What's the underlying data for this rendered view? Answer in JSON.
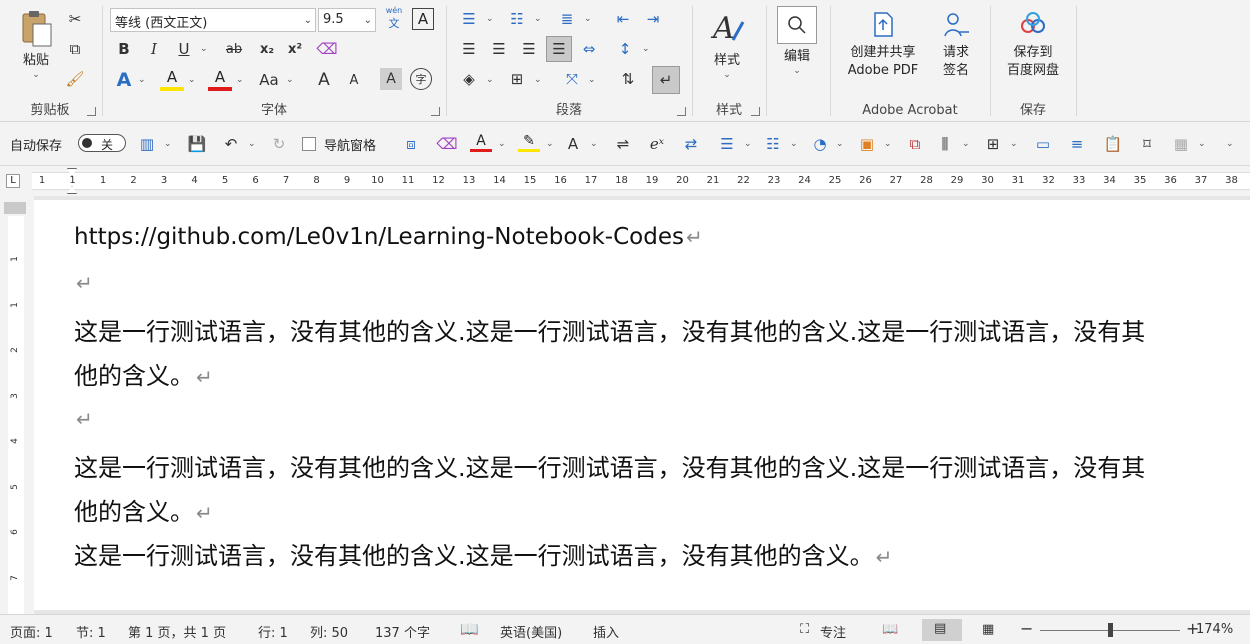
{
  "ribbon": {
    "clipboard": {
      "label": "剪贴板",
      "paste_label": "粘贴"
    },
    "font": {
      "label": "字体",
      "font_name": "等线 (西文正文)",
      "font_size": "9.5",
      "pinyin_top": "wén",
      "pinyin_bottom": "文",
      "border_char": "A",
      "bold": "B",
      "italic": "I",
      "underline": "U",
      "strike": "ab",
      "subscript": "x₂",
      "superscript": "x²",
      "text_effects": "A",
      "highlight": "A",
      "font_color": "A",
      "change_case": "Aa",
      "grow": "A",
      "shrink": "A",
      "shading": "A",
      "enclose": "字"
    },
    "paragraph": {
      "label": "段落"
    },
    "styles": {
      "label": "样式",
      "button_label": "样式"
    },
    "editing": {
      "button_label": "编辑"
    },
    "acrobat": {
      "label": "Adobe Acrobat",
      "create_share_l1": "创建并共享",
      "create_share_l2": "Adobe PDF",
      "request_sign_l1": "请求",
      "request_sign_l2": "签名"
    },
    "save": {
      "label": "保存",
      "save_to_l1": "保存到",
      "save_to_l2": "百度网盘"
    }
  },
  "qat": {
    "autosave_label": "自动保存",
    "autosave_state": "关",
    "nav_pane_label": "导航窗格"
  },
  "ruler": {
    "h_numbers": [
      "1",
      "1",
      "1",
      "2",
      "3",
      "4",
      "5",
      "6",
      "7",
      "8",
      "9",
      "10",
      "11",
      "12",
      "13",
      "14",
      "15",
      "16",
      "17",
      "18",
      "19",
      "20",
      "21",
      "22",
      "23",
      "24",
      "25",
      "26",
      "27",
      "28",
      "29",
      "30",
      "31",
      "32",
      "33",
      "34",
      "35",
      "36",
      "37",
      "38"
    ],
    "v_numbers": [
      "1",
      "1",
      "2",
      "3",
      "4",
      "5",
      "6",
      "7",
      "8"
    ]
  },
  "document": {
    "paragraphs": [
      "https://github.com/Le0v1n/Learning-Notebook-Codes",
      "",
      "这是一行测试语言，没有其他的含义.这是一行测试语言，没有其他的含义.这是一行测试语言，没有其",
      "他的含义。",
      "",
      "这是一行测试语言，没有其他的含义.这是一行测试语言，没有其他的含义.这是一行测试语言，没有其",
      "他的含义。",
      "这是一行测试语言，没有其他的含义.这是一行测试语言，没有其他的含义。"
    ],
    "para_mark": "↵"
  },
  "status": {
    "page": "页面: 1",
    "section": "节: 1",
    "page_of": "第 1 页，共 1 页",
    "line": "行: 1",
    "column": "列: 50",
    "word_count": "137 个字",
    "language": "英语(美国)",
    "insert_mode": "插入",
    "focus": "专注",
    "zoom_minus": "−",
    "zoom_plus": "+",
    "zoom": "174%"
  }
}
